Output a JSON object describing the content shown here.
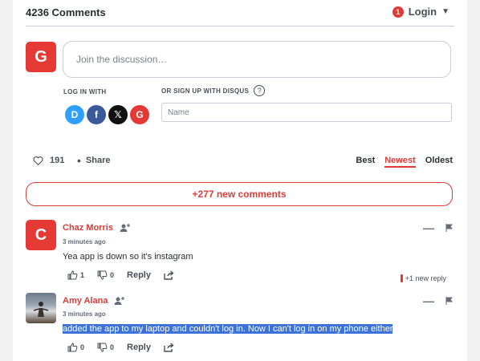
{
  "header": {
    "comment_count": "4236 Comments",
    "notification_count": "1",
    "login_label": "Login"
  },
  "composer": {
    "avatar_letter": "G",
    "placeholder": "Join the discussion…",
    "login_with_label": "LOG IN WITH",
    "signup_label": "OR SIGN UP WITH DISQUS",
    "help_symbol": "?",
    "social": [
      {
        "name": "Disqus",
        "letter": "D",
        "color": "#2e9fff"
      },
      {
        "name": "Facebook",
        "letter": "f",
        "color": "#3b5998"
      },
      {
        "name": "X",
        "letter": "𝕏",
        "color": "#111111"
      },
      {
        "name": "Google",
        "letter": "G",
        "color": "#e53935"
      }
    ],
    "name_placeholder": "Name"
  },
  "toolbar": {
    "favorites_count": "191",
    "share_label": "Share",
    "sort_options": [
      "Best",
      "Newest",
      "Oldest"
    ],
    "active_sort": "Newest"
  },
  "new_comments_banner": "+277 new comments",
  "comments": [
    {
      "author": "Chaz Morris",
      "avatar_letter": "C",
      "time": "3 minutes ago",
      "text": "Yea app is down so it's instagram",
      "upvotes": "1",
      "downvotes": "0",
      "reply_label": "Reply",
      "new_reply": "+1 new reply"
    },
    {
      "author": "Amy Alana",
      "time": "3 minutes ago",
      "text": "added the app to my laptop and couldn't log in. Now I can't log in on my phone either",
      "upvotes": "0",
      "downvotes": "0",
      "reply_label": "Reply"
    }
  ],
  "colors": {
    "accent": "#e53935",
    "selection": "#3d73d8"
  }
}
